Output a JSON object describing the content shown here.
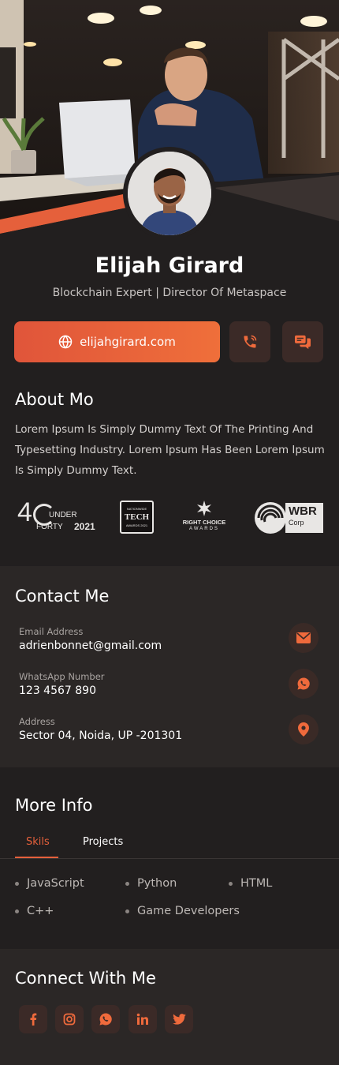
{
  "profile": {
    "name": "Elijah Girard",
    "role": "Blockchain Expert | Director Of Metaspace",
    "website": "elijahgirard.com"
  },
  "about": {
    "heading": "About Mo",
    "text": "Lorem Ipsum Is Simply Dummy Text Of The Printing And Typesetting Industry. Lorem Ipsum Has Been Lorem Ipsum Is Simply Dummy Text."
  },
  "awards": {
    "forty": {
      "num": "4",
      "top": "UNDER",
      "bottom": "FORTY",
      "year": "2021"
    },
    "tech": {
      "top": "NATIONWIDE",
      "mid": "TECH",
      "bottom": "AWARDS 2021"
    },
    "right_choice": {
      "top": "RIGHT CHOICE",
      "bottom": "AWARDS"
    },
    "wbr": {
      "top": "WBR",
      "bottom": "Corp"
    }
  },
  "contact": {
    "heading": "Contact Me",
    "items": [
      {
        "label": "Email Address",
        "value": "adrienbonnet@gmail.com",
        "icon": "mail-icon"
      },
      {
        "label": "WhatsApp  Number",
        "value": "123 4567 890",
        "icon": "whatsapp-icon"
      },
      {
        "label": "Address",
        "value": "Sector 04, Noida, UP -201301",
        "icon": "location-pin-icon"
      }
    ]
  },
  "more_info": {
    "heading": "More Info",
    "tabs": [
      {
        "label": "Skils",
        "active": true
      },
      {
        "label": "Projects",
        "active": false
      }
    ],
    "skills": [
      "JavaScript",
      "Python",
      "HTML",
      "C++",
      "Game Developers"
    ]
  },
  "connect": {
    "heading": "Connect With Me",
    "socials": [
      "facebook-icon",
      "instagram-icon",
      "whatsapp-icon",
      "linkedin-icon",
      "twitter-icon"
    ]
  },
  "colors": {
    "accent": "#e9623a",
    "background": "#221f1f",
    "panel": "#2b2726",
    "icon_bg": "#3b2a27"
  }
}
